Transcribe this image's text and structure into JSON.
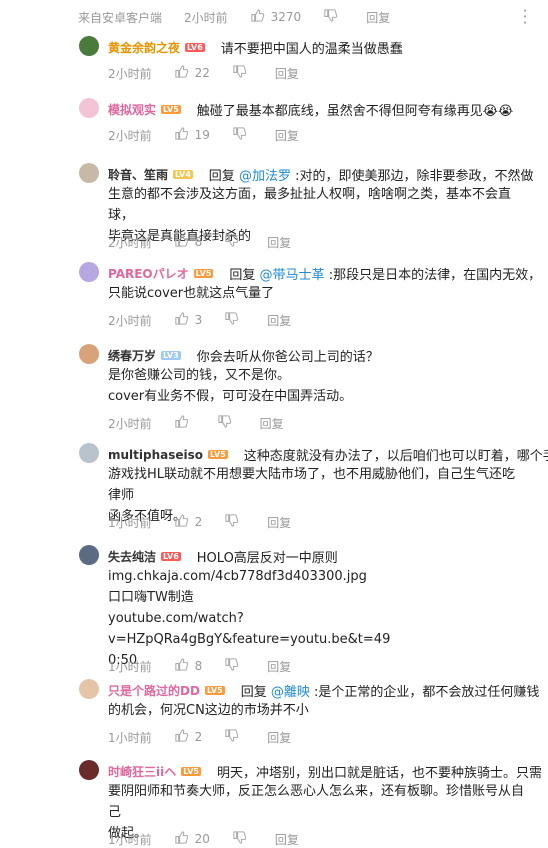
{
  "top": {
    "source": "来自安卓客户端",
    "time": "2小时前",
    "likes": "3270",
    "reply": "回复"
  },
  "comments": [
    {
      "user": "黄金余韵之夜",
      "level": "LV6",
      "name_color": "#e89400",
      "lead": "请不要把中国人的温柔当做愚蠢",
      "mention": "",
      "text_after_mention": "",
      "lines": [],
      "time": "2小时前",
      "likes": "22",
      "reply": "回复",
      "avatar_color": "#4a7a3c"
    },
    {
      "user": "模拟观实",
      "level": "LV5",
      "name_color": "#e2679c",
      "lead": "触碰了最基本都底线，虽然舍不得但阿夸有缘再见😭😭",
      "mention": "",
      "text_after_mention": "",
      "lines": [],
      "time": "2小时前",
      "likes": "19",
      "reply": "回复",
      "avatar_color": "#f3c3d6"
    },
    {
      "user": "聆音、笙雨",
      "level": "LV4",
      "name_color": "#333333",
      "lead": "回复",
      "mention": "@加法罗",
      "text_after_mention": ":对的，即使美那边，除非要参政，不然做",
      "lines": [
        "生意的都不会涉及这方面，最多扯扯人权啊，啥啥啊之类，基本不会直球，",
        "毕竟这是真能直接封杀的"
      ],
      "time": "2小时前",
      "likes": "8",
      "reply": "回复",
      "avatar_color": "#c7b9a6"
    },
    {
      "user": "PAREOパレオ",
      "level": "LV5",
      "name_color": "#e2679c",
      "lead": "回复",
      "mention": "@带马士革",
      "text_after_mention": ":那段只是日本的法律，在国内无效，",
      "lines": [
        "只能说cover也就这点气量了"
      ],
      "time": "2小时前",
      "likes": "3",
      "reply": "回复",
      "avatar_color": "#b8a6e0"
    },
    {
      "user": "绣春万岁",
      "level": "LV3",
      "name_color": "#333333",
      "lead": "你会去听从你爸公司上司的话？",
      "mention": "",
      "text_after_mention": "",
      "lines": [
        "是你爸赚公司的钱，又不是你。",
        "cover有业务不假，可可没在中国弄活动。"
      ],
      "time": "2小时前",
      "likes": "",
      "reply": "回复",
      "avatar_color": "#d8a37a"
    },
    {
      "user": "multiphaseiso",
      "level": "LV5",
      "name_color": "#333333",
      "lead": "这种态度就没有办法了，以后咱们也可以盯着，哪个手",
      "mention": "",
      "text_after_mention": "",
      "lines": [
        "游戏找HL联动就不用想要大陆市场了，也不用威胁他们，自己生气还吃律师",
        "函多不值呀。"
      ],
      "time": "1小时前",
      "likes": "2",
      "reply": "回复",
      "avatar_color": "#b9c3cc"
    },
    {
      "user": "失去纯洁",
      "level": "LV6",
      "name_color": "#333333",
      "lead": "HOLO高层反对一中原则",
      "mention": "",
      "text_after_mention": "",
      "lines": [
        "img.chkaja.com/4cb778df3d403300.jpg",
        "口口嗨TW制造",
        "youtube.com/watch?v=HZpQRa4gBgY&feature=youtu.be&t=49",
        "0:50"
      ],
      "time": "1小时前",
      "likes": "8",
      "reply": "回复",
      "avatar_color": "#5b6b82"
    },
    {
      "user": "只是个路过的DD",
      "level": "LV5",
      "name_color": "#e2679c",
      "lead": "回复",
      "mention": "@離映",
      "text_after_mention": ":是个正常的企业，都不会放过任何赚钱",
      "lines": [
        "的机会，何况CN这边的市场并不小"
      ],
      "time": "1小时前",
      "likes": "2",
      "reply": "回复",
      "avatar_color": "#e3c6a8"
    },
    {
      "user": "时崎狂三iiヘ",
      "level": "LV5",
      "name_color": "#e2679c",
      "lead": "明天，冲塔别，别出口就是脏话，也不要种族骑士。只需",
      "mention": "",
      "text_after_mention": "",
      "lines": [
        "要阴阳师和节奏大师，反正怎么恶心人怎么来，还有板聊。珍惜账号从自己",
        "做起。"
      ],
      "time": "1小时前",
      "likes": "20",
      "reply": "回复",
      "avatar_color": "#6a2b2b"
    }
  ],
  "colors": {
    "meta": "#999999",
    "mention": "#1e8ad6",
    "text": "#222222"
  }
}
